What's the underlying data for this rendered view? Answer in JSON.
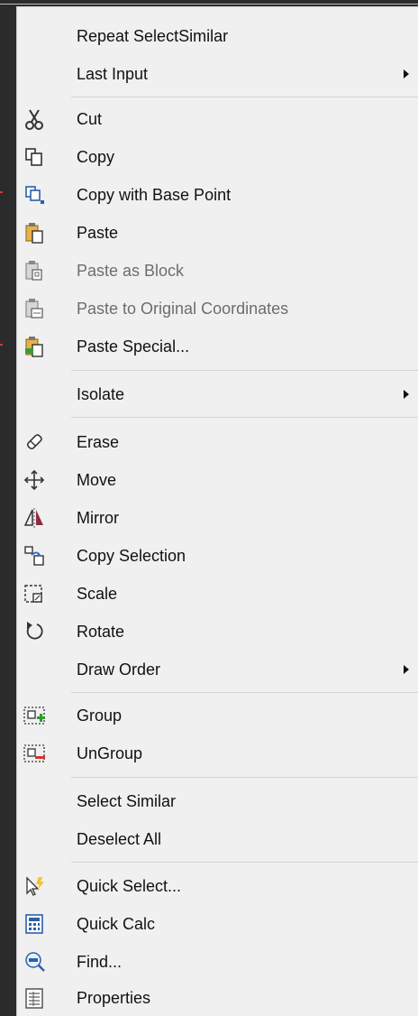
{
  "menu": {
    "items": [
      {
        "label": "Repeat SelectSimilar",
        "icon": "none"
      },
      {
        "label": "Last Input",
        "icon": "none",
        "submenu": true
      },
      {
        "label": "Cut",
        "icon": "scissors-icon"
      },
      {
        "label": "Copy",
        "icon": "copy-icon"
      },
      {
        "label": "Copy with Base Point",
        "icon": "copy-base-point-icon"
      },
      {
        "label": "Paste",
        "icon": "paste-icon"
      },
      {
        "label": "Paste as Block",
        "icon": "paste-block-icon",
        "disabled": true
      },
      {
        "label": "Paste to Original Coordinates",
        "icon": "paste-original-icon",
        "disabled": true
      },
      {
        "label": "Paste Special...",
        "icon": "paste-special-icon"
      },
      {
        "label": "Isolate",
        "icon": "none",
        "submenu": true
      },
      {
        "label": "Erase",
        "icon": "eraser-icon"
      },
      {
        "label": "Move",
        "icon": "move-icon"
      },
      {
        "label": "Mirror",
        "icon": "mirror-icon"
      },
      {
        "label": "Copy Selection",
        "icon": "copy-selection-icon"
      },
      {
        "label": "Scale",
        "icon": "scale-icon"
      },
      {
        "label": "Rotate",
        "icon": "rotate-icon"
      },
      {
        "label": "Draw Order",
        "icon": "none",
        "submenu": true
      },
      {
        "label": "Group",
        "icon": "group-icon"
      },
      {
        "label": "UnGroup",
        "icon": "ungroup-icon"
      },
      {
        "label": "Select Similar",
        "icon": "none"
      },
      {
        "label": "Deselect All",
        "icon": "none"
      },
      {
        "label": "Quick Select...",
        "icon": "quick-select-icon"
      },
      {
        "label": "Quick Calc",
        "icon": "calculator-icon"
      },
      {
        "label": "Find...",
        "icon": "find-icon"
      },
      {
        "label": "Properties",
        "icon": "properties-icon"
      }
    ]
  },
  "colors": {
    "menu_bg": "#f0f0f0",
    "text": "#111111",
    "disabled_text": "#6d6d6d",
    "separator": "#d4d4d4"
  }
}
